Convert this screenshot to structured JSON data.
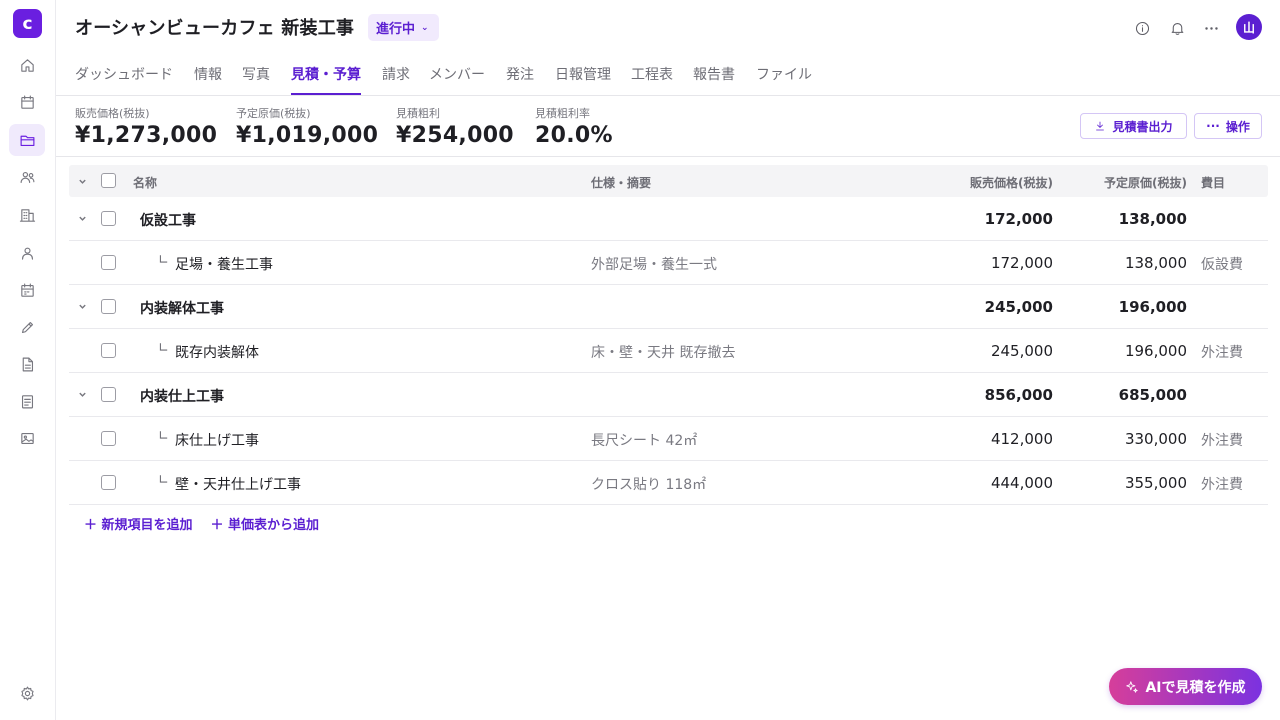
{
  "app": {
    "logo_letter": "c"
  },
  "header": {
    "title": "オーシャンビューカフェ 新装工事",
    "status": "進行中",
    "avatar_initial": "山"
  },
  "tabs": [
    {
      "label": "ダッシュボード"
    },
    {
      "label": "情報"
    },
    {
      "label": "写真"
    },
    {
      "label": "見積・予算",
      "active": true
    },
    {
      "label": "請求"
    },
    {
      "label": "メンバー"
    },
    {
      "label": "発注"
    },
    {
      "label": "日報管理"
    },
    {
      "label": "工程表"
    },
    {
      "label": "報告書"
    },
    {
      "label": "ファイル"
    }
  ],
  "summary": {
    "metrics": [
      {
        "label": "販売価格(税抜)",
        "value": "¥1,273,000"
      },
      {
        "label": "予定原価(税抜)",
        "value": "¥1,019,000"
      },
      {
        "label": "見積粗利",
        "value": "¥254,000"
      },
      {
        "label": "見積粗利率",
        "value": "20.0%"
      }
    ],
    "export_label": "見積書出力",
    "actions_label": "操作"
  },
  "table": {
    "columns": {
      "name": "名称",
      "spec": "仕様・摘要",
      "sale": "販売価格(税抜)",
      "cost": "予定原価(税抜)",
      "category": "費目"
    },
    "rows": [
      {
        "type": "group",
        "name": "仮設工事",
        "sale": "172,000",
        "cost": "138,000"
      },
      {
        "type": "child",
        "name": "足場・養生工事",
        "spec": "外部足場・養生一式",
        "sale": "172,000",
        "cost": "138,000",
        "category": "仮設費"
      },
      {
        "type": "group",
        "name": "内装解体工事",
        "sale": "245,000",
        "cost": "196,000"
      },
      {
        "type": "child",
        "name": "既存内装解体",
        "spec": "床・壁・天井 既存撤去",
        "sale": "245,000",
        "cost": "196,000",
        "category": "外注費"
      },
      {
        "type": "group",
        "name": "内装仕上工事",
        "sale": "856,000",
        "cost": "685,000"
      },
      {
        "type": "child",
        "name": "床仕上げ工事",
        "spec": "長尺シート 42㎡",
        "sale": "412,000",
        "cost": "330,000",
        "category": "外注費"
      },
      {
        "type": "child",
        "name": "壁・天井仕上げ工事",
        "spec": "クロス貼り 118㎡",
        "sale": "444,000",
        "cost": "355,000",
        "category": "外注費"
      }
    ],
    "tree_mark": "∟"
  },
  "add": {
    "new_item": "＋ 新規項目を追加",
    "from_price_list": "＋ 単価表から追加"
  },
  "ai_button": "AIで見積を作成",
  "icons": {
    "sidebar": [
      "home-icon",
      "calendar-icon",
      "folder-icon",
      "users-icon",
      "building-icon",
      "user-icon",
      "schedule-icon",
      "pencil-icon",
      "document-icon",
      "list-icon",
      "image-icon",
      "gear-icon"
    ],
    "header": [
      "info-icon",
      "bell-icon",
      "more-icon"
    ]
  },
  "colors": {
    "accent": "#5b1fd1",
    "logo": "#6a1fe0"
  }
}
